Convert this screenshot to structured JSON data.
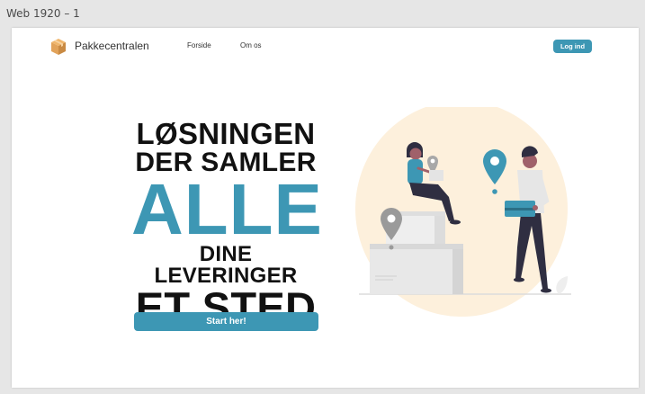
{
  "artboard": {
    "label": "Web 1920 – 1"
  },
  "nav": {
    "brand": "Pakkecentralen",
    "links": [
      "Forside",
      "Om os"
    ],
    "login_label": "Log ind"
  },
  "hero": {
    "line1": "LØSNINGEN",
    "line2": "DER SAMLER",
    "line3": "ALLE",
    "line4": "DINE LEVERINGER",
    "line5": "ET STED",
    "cta_label": "Start her!"
  },
  "colors": {
    "accent": "#3d97b4",
    "blob": "#fdf0dc",
    "box_icon": "#e2a35a",
    "text": "#111111"
  },
  "icons": {
    "logo": "package-box-icon",
    "illustration": "delivery-illustration"
  }
}
